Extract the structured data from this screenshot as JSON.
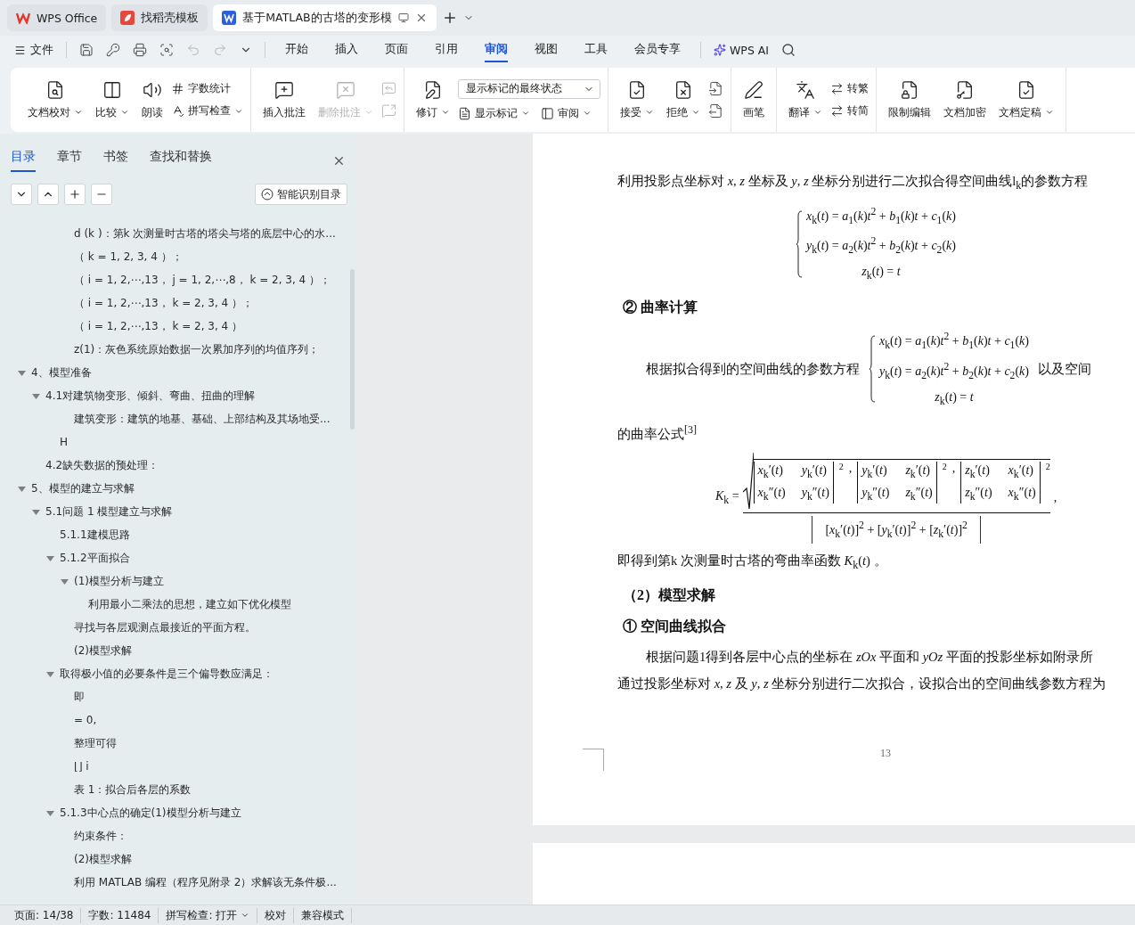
{
  "browser_tabs": [
    {
      "label": "WPS Office",
      "selected": false,
      "kind": "home"
    },
    {
      "label": "找稻壳模板",
      "selected": false,
      "kind": "template"
    },
    {
      "label": "基于MATLAB的古塔的变形模",
      "selected": true,
      "kind": "document"
    }
  ],
  "menu": {
    "file": "文件",
    "tabs": [
      {
        "label": "开始",
        "selected": false
      },
      {
        "label": "插入",
        "selected": false
      },
      {
        "label": "页面",
        "selected": false
      },
      {
        "label": "引用",
        "selected": false
      },
      {
        "label": "审阅",
        "selected": true
      },
      {
        "label": "视图",
        "selected": false
      },
      {
        "label": "工具",
        "selected": false
      },
      {
        "label": "会员专享",
        "selected": false
      }
    ],
    "ai": "WPS AI"
  },
  "ribbon": {
    "groups": [
      {
        "items": [
          {
            "kind": "large",
            "label": "文档校对",
            "dropdown": true,
            "disabled": false
          },
          {
            "kind": "large",
            "label": "比较",
            "dropdown": true,
            "disabled": false
          },
          {
            "kind": "large",
            "label": "朗读",
            "dropdown": false,
            "disabled": false
          },
          {
            "kind": "column",
            "items": [
              {
                "kind": "small",
                "label": "字数统计",
                "dropdown": false,
                "disabled": false
              },
              {
                "kind": "small",
                "label": "拼写检查",
                "dropdown": true,
                "disabled": false
              }
            ]
          }
        ]
      },
      {
        "items": [
          {
            "kind": "large",
            "label": "插入批注",
            "dropdown": false,
            "disabled": false
          },
          {
            "kind": "large",
            "label": "删除批注",
            "dropdown": true,
            "disabled": true
          },
          {
            "kind": "column",
            "items": [
              {
                "kind": "icon",
                "disabled": true
              },
              {
                "kind": "icon",
                "disabled": true
              }
            ]
          }
        ]
      },
      {
        "items": [
          {
            "kind": "large",
            "label": "修订",
            "dropdown": true,
            "disabled": false
          },
          {
            "kind": "column",
            "items": [
              {
                "kind": "select",
                "value": "显示标记的最终状态"
              },
              {
                "kind": "row",
                "items": [
                  {
                    "kind": "small",
                    "label": "显示标记",
                    "dropdown": true,
                    "disabled": false
                  },
                  {
                    "kind": "small",
                    "label": "审阅",
                    "dropdown": true,
                    "disabled": false
                  }
                ]
              }
            ]
          }
        ]
      },
      {
        "items": [
          {
            "kind": "large",
            "label": "接受",
            "dropdown": true,
            "disabled": false
          },
          {
            "kind": "large",
            "label": "拒绝",
            "dropdown": true,
            "disabled": false
          },
          {
            "kind": "column",
            "items": [
              {
                "kind": "icon",
                "disabled": false
              },
              {
                "kind": "icon",
                "disabled": false
              }
            ]
          }
        ]
      },
      {
        "items": [
          {
            "kind": "large",
            "label": "画笔",
            "dropdown": false,
            "disabled": false
          }
        ]
      },
      {
        "items": [
          {
            "kind": "large",
            "label": "翻译",
            "dropdown": true,
            "disabled": false
          },
          {
            "kind": "column",
            "items": [
              {
                "kind": "small",
                "label": "转繁",
                "dropdown": false,
                "disabled": false
              },
              {
                "kind": "small",
                "label": "转简",
                "dropdown": false,
                "disabled": false
              }
            ]
          }
        ]
      },
      {
        "items": [
          {
            "kind": "large",
            "label": "限制编辑",
            "dropdown": false,
            "disabled": false
          },
          {
            "kind": "large",
            "label": "文档加密",
            "dropdown": false,
            "disabled": false
          },
          {
            "kind": "large",
            "label": "文档定稿",
            "dropdown": true,
            "disabled": false
          }
        ]
      }
    ]
  },
  "side_panel": {
    "tabs": [
      {
        "label": "目录",
        "selected": true
      },
      {
        "label": "章节",
        "selected": false
      },
      {
        "label": "书签",
        "selected": false
      },
      {
        "label": "查找和替换",
        "selected": false
      }
    ],
    "smart_button": "智能识别目录",
    "outline": [
      {
        "children": [
          {
            "children": [
              {
                "children": [
                  {
                    "label": "d (k )：第k 次测量时古塔的塔尖与塔的底层中心的水..."
                  },
                  {
                    "label": "（ k = 1, 2, 3, 4 ）；"
                  },
                  {
                    "label": "（ i = 1, 2,⋯,13， j = 1, 2,⋯,8， k = 2, 3, 4 ）；"
                  },
                  {
                    "label": "（ i = 1, 2,⋯,13， k = 2, 3, 4 ）；"
                  },
                  {
                    "label": "（ i = 1, 2,⋯,13， k = 2, 3, 4 ）"
                  },
                  {
                    "label": "z(1)：灰色系统原始数据一次累加序列的均值序列；"
                  }
                ]
              }
            ]
          }
        ]
      },
      {
        "label": "4、模型准备",
        "expanded": true,
        "children": [
          {
            "label": "4.1对建筑物变形、倾斜、弯曲、扭曲的理解",
            "expanded": true,
            "children": [
              {
                "children": [
                  {
                    "label": "建筑变形：建筑的地基、基础、上部结构及其场地受..."
                  }
                ]
              },
              {
                "label": "H"
              }
            ]
          },
          {
            "label": "4.2缺失数据的预处理："
          }
        ]
      },
      {
        "label": "5、模型的建立与求解",
        "expanded": true,
        "children": [
          {
            "label": "5.1问题 1 模型建立与求解",
            "expanded": true,
            "children": [
              {
                "label": "5.1.1建模思路"
              },
              {
                "label": "5.1.2平面拟合",
                "expanded": true,
                "children": [
                  {
                    "label": "(1)模型分析与建立",
                    "expanded": true,
                    "children": [
                      {
                        "label": "利用最小二乘法的思想，建立如下优化模型"
                      }
                    ]
                  },
                  {
                    "label": "寻找与各层观测点最接近的平面方程。"
                  },
                  {
                    "label": "(2)模型求解"
                  }
                ]
              },
              {
                "label": "取得极小值的必要条件是三个偏导数应满足：",
                "expanded": true,
                "children": [
                  {
                    "label": "即"
                  },
                  {
                    "label": "= 0,"
                  },
                  {
                    "label": "整理可得"
                  },
                  {
                    "label": "⌊⌋ i"
                  },
                  {
                    "label": "表 1：拟合后各层的系数"
                  }
                ]
              },
              {
                "label": "5.1.3中心点的确定(1)模型分析与建立",
                "expanded": true,
                "children": [
                  {
                    "label": "约束条件："
                  },
                  {
                    "label": "(2)模型求解"
                  },
                  {
                    "label": "利用 MATLAB 编程（程序见附录 2）求解该无条件极..."
                  }
                ]
              }
            ]
          }
        ]
      }
    ]
  },
  "document": {
    "blocks": [
      {
        "kind": "para",
        "text": "利用投影点坐标对 *x*, *z* 坐标及 *y*, *z* 坐标分别进行二次拟合得空间曲线l$_{k}$的参数方程"
      },
      {
        "kind": "system",
        "lines": [
          "*x*$_{k}$(*t*) = *a*$_{1}$(*k*)*t*$^{2}$ + *b*$_{1}$(*k*)*t* + *c*$_{1}$(*k*)",
          "*y*$_{k}$(*t*) = *a*$_{2}$(*k*)*t*$^{2}$ + *b*$_{2}$(*k*)*t* + *c*$_{2}$(*k*)",
          "*z*$_{k}$(*t*) = *t*"
        ]
      },
      {
        "kind": "heading",
        "text": "② 曲率计算"
      },
      {
        "kind": "inline_system",
        "before": "根据拟合得到的空间曲线的参数方程",
        "after": "以及空间",
        "lines": [
          "*x*$_{k}$(*t*) = *a*$_{1}$(*k*)*t*$^{2}$ + *b*$_{1}$(*k*)*t* + *c*$_{1}$(*k*)",
          "*y*$_{k}$(*t*) = *a*$_{2}$(*k*)*t*$^{2}$ + *b*$_{2}$(*k*)*t* + *c*$_{2}$(*k*)",
          "*z*$_{k}$(*t*) = *t*"
        ]
      },
      {
        "kind": "para",
        "text": "的曲率公式$^{[3]}$"
      },
      {
        "kind": "curvature",
        "lhs": "*K*$_{k}$ =",
        "exponents": [
          "2",
          "2",
          "2"
        ],
        "separators": [
          ",",
          ","
        ],
        "end": ",",
        "determinants": [
          [
            "*x*$_{k}$′(*t*)",
            "*y*$_{k}$′(*t*)",
            "*x*$_{k}$″(*t*)",
            "*y*$_{k}$″(*t*)"
          ],
          [
            "*y*$_{k}$′(*t*)",
            "*z*$_{k}$′(*t*)",
            "*y*$_{k}$″(*t*)",
            "*z*$_{k}$″(*t*)"
          ],
          [
            "*z*$_{k}$′(*t*)",
            "*x*$_{k}$′(*t*)",
            "*z*$_{k}$″(*t*)",
            "*x*$_{k}$″(*t*)"
          ]
        ],
        "denominator": "[*x*$_{k}$′(*t*)]$^{2}$ + [*y*$_{k}$′(*t*)]$^{2}$ + [*z*$_{k}$′(*t*)]$^{2}$"
      },
      {
        "kind": "para",
        "text": "即得到第k 次测量时古塔的弯曲率函数 *K*$_{k}$(*t*) 。"
      },
      {
        "kind": "heading",
        "text": "（2）模型求解"
      },
      {
        "kind": "heading",
        "text": "① 空间曲线拟合"
      },
      {
        "kind": "indented_para",
        "text": "根据问题1得到各层中心点的坐标在 *zOx* 平面和 *yOz* 平面的投影坐标如附录所"
      },
      {
        "kind": "para",
        "text": "通过投影坐标对 *x*, *z* 及 *y*, *z* 坐标分别进行二次拟合，设拟合出的空间曲线参数方程为"
      }
    ],
    "page_number": "13"
  },
  "status_bar": [
    {
      "label": "页面: 14/38",
      "dropdown": false
    },
    {
      "label": "字数: 11484",
      "dropdown": false
    },
    {
      "label": "拼写检查: 打开",
      "dropdown": true
    },
    {
      "label": "校对",
      "dropdown": false
    },
    {
      "label": "兼容模式",
      "dropdown": false
    }
  ]
}
